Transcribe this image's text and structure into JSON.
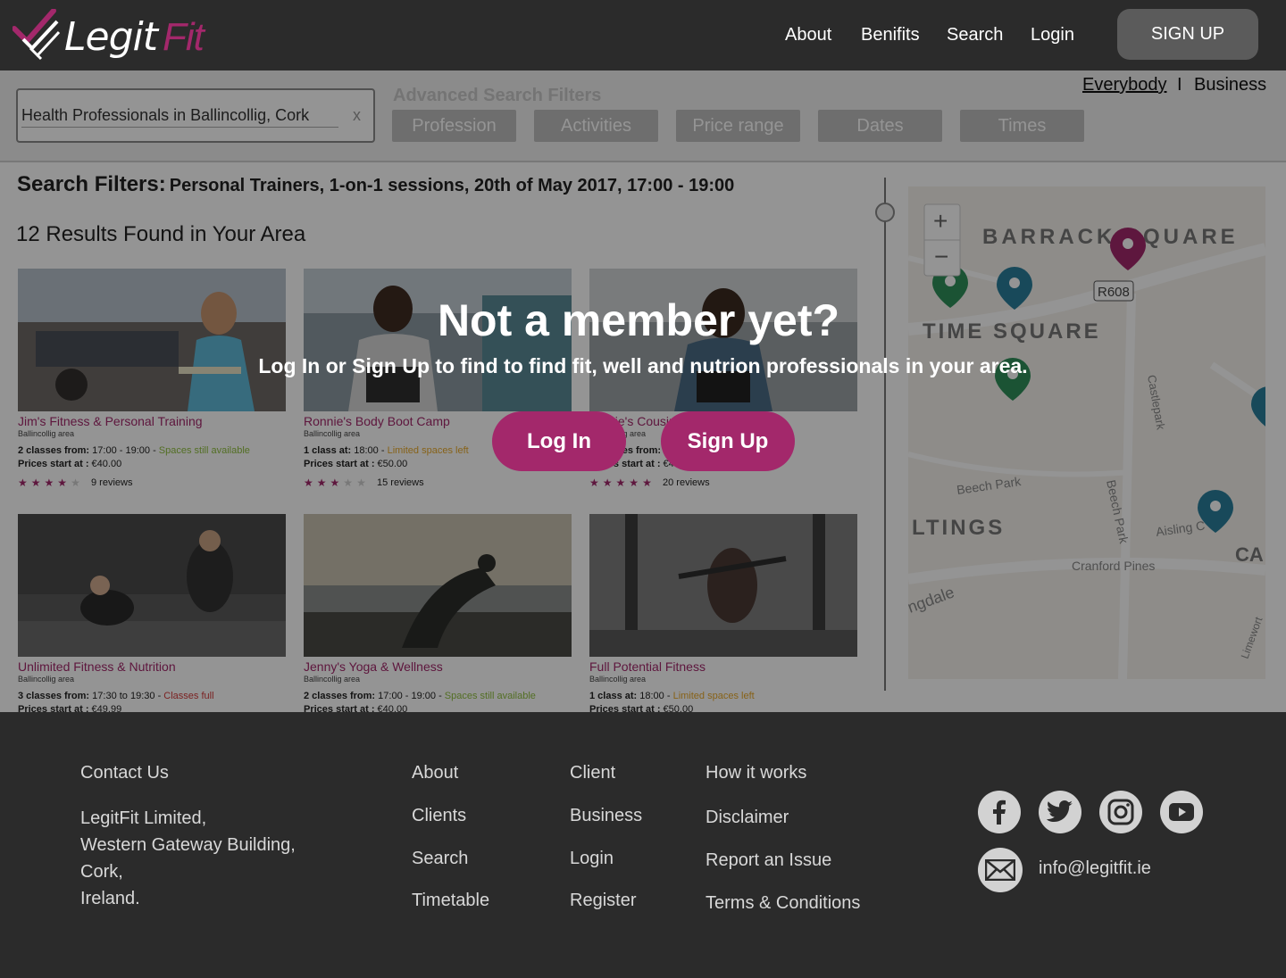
{
  "header": {
    "logo_main": "Legit",
    "logo_accent": "Fit",
    "nav": [
      "About",
      "Benifits",
      "Search",
      "Login"
    ],
    "signup_label": "SIGN UP"
  },
  "search": {
    "input_value": "Health Professionals in Ballincollig, Cork",
    "clear_label": "x",
    "advanced_title": "Advanced Search Filters",
    "filters": [
      "Profession",
      "Activities",
      "Price range",
      "Dates",
      "Times"
    ],
    "audience": [
      "Everybody",
      "Business"
    ],
    "audience_separator": "I"
  },
  "results": {
    "filters_label": "Search Filters:",
    "filters_value": "Personal Trainers, 1-on-1 sessions,  20th of May 2017, 17:00 - 19:00",
    "count_label": "12 Results Found in Your Area",
    "cards": [
      {
        "title": "Jim's Fitness & Personal Training",
        "area": "Ballincollig area",
        "classes_label": "2 classes from:",
        "classes_time": "17:00 - 19:00",
        "availability": "Spaces still available",
        "availability_color": "#8fbf3f",
        "prices_label": "Prices start at :",
        "price": "€40.00",
        "rating": 4,
        "reviews": "9 reviews"
      },
      {
        "title": "Ronnie's Body Boot Camp",
        "area": "Ballincollig area",
        "classes_label": "1 class at:",
        "classes_time": "18:00",
        "availability": "Limited spaces left",
        "availability_color": "#e8a92a",
        "prices_label": "Prices start at :",
        "price": "€50.00",
        "rating": 3,
        "reviews": "15 reviews"
      },
      {
        "title": "Jackie's Cousins Boot Camp",
        "area": "Ballincollig area",
        "classes_label": "2 classes from:",
        "classes_time": "",
        "availability": "",
        "availability_color": "#8fbf3f",
        "prices_label": "Prices start at :",
        "price": "€4",
        "rating": 5,
        "reviews": "20 reviews"
      },
      {
        "title": "Unlimited Fitness & Nutrition",
        "area": "Ballincollig area",
        "classes_label": "3 classes from:",
        "classes_time": "17:30 to 19:30 -",
        "availability": "Classes full",
        "availability_color": "#d43b3b",
        "prices_label": "Prices start at :",
        "price": "€49.99",
        "rating": 0,
        "reviews": ""
      },
      {
        "title": "Jenny's Yoga & Wellness",
        "area": "Ballincollig area",
        "classes_label": "2 classes from:",
        "classes_time": "17:00 - 19:00",
        "availability": "Spaces still available",
        "availability_color": "#8fbf3f",
        "prices_label": "Prices start at :",
        "price": "€40.00",
        "rating": 0,
        "reviews": ""
      },
      {
        "title": "Full Potential Fitness",
        "area": "Ballincollig area",
        "classes_label": "1 class at:",
        "classes_time": "18:00",
        "availability": "Limited spaces left",
        "availability_color": "#e8a92a",
        "prices_label": "Prices start at :",
        "price": "€50.00",
        "rating": 0,
        "reviews": ""
      }
    ]
  },
  "map": {
    "labels": [
      "BARRACK SQUARE",
      "R608",
      "TIME SQUARE",
      "Castlepark",
      "Beech Park",
      "Beech Park",
      "LTINGS",
      "Aisling C",
      "CA",
      "Cranford Pines",
      "ngdale",
      "Limewort"
    ],
    "zoom_in": "+",
    "zoom_out": "−"
  },
  "modal": {
    "title": "Not a member yet?",
    "subtitle": "Log In or Sign Up to find to find fit, well and nutrion professionals in your area.",
    "login_label": "Log In",
    "signup_label": "Sign Up"
  },
  "footer": {
    "contact_title": "Contact Us",
    "address": [
      "LegitFit Limited,",
      "Western Gateway Building,",
      "Cork,",
      "Ireland."
    ],
    "col1": [
      "About",
      "Clients",
      "Search",
      "Timetable"
    ],
    "col2": [
      "Client",
      "Business",
      "Login",
      "Register"
    ],
    "col3": [
      "How it works",
      "Disclaimer",
      "Report an Issue",
      "Terms & Conditions"
    ],
    "email": "info@legitfit.ie"
  },
  "colors": {
    "accent": "#a3286b",
    "dark": "#2b2b2b",
    "map_teal": "#2a7f9b",
    "map_green": "#2f8f5a"
  },
  "icons": [
    "logo-check-icon",
    "facebook-icon",
    "twitter-icon",
    "instagram-icon",
    "youtube-icon",
    "mail-icon",
    "map-pin-icon",
    "star-icon"
  ]
}
